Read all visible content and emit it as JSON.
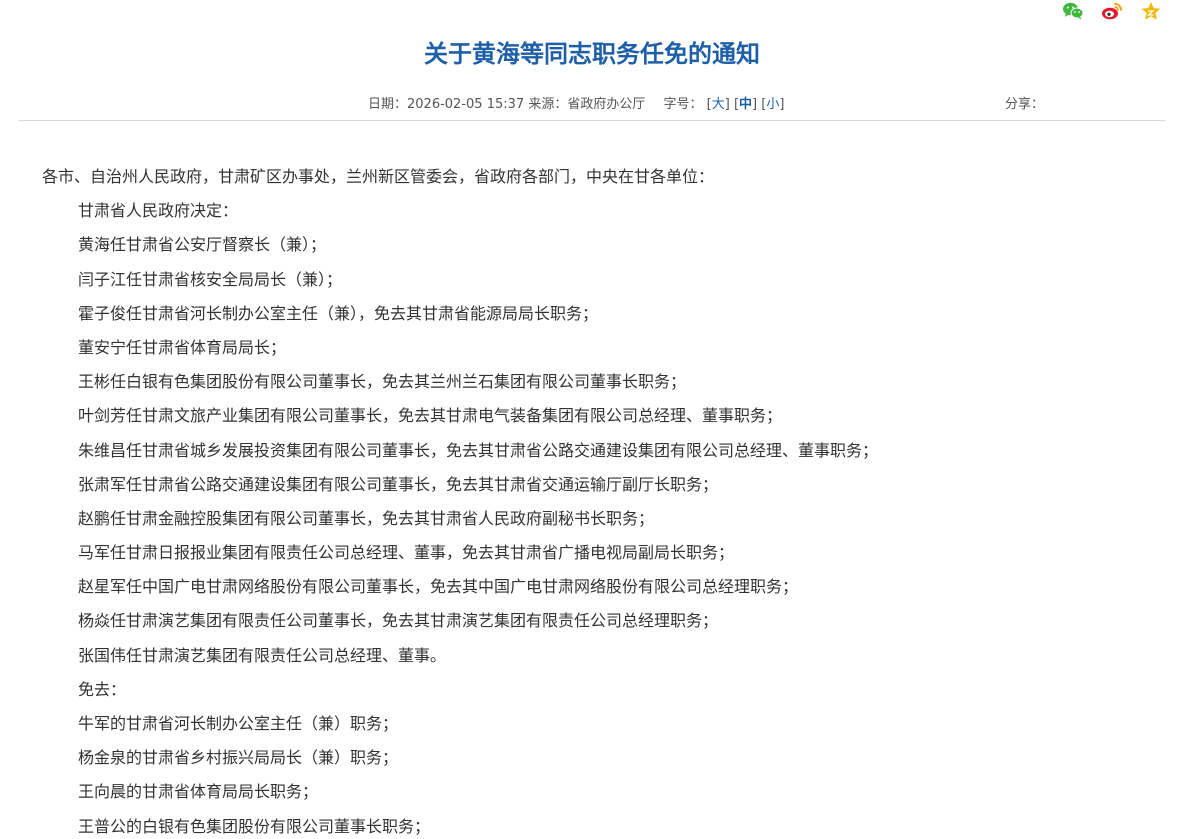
{
  "article": {
    "title": "关于黄海等同志职务任免的通知",
    "date_label": "日期：",
    "date": "2026-02-05 15:37",
    "source_label": "来源：",
    "source": "省政府办公厅",
    "fontsize_label": "字号：",
    "fontsize_options": [
      "大",
      "中",
      "小"
    ],
    "fontsize_selected": "中",
    "share_label": "分享："
  },
  "share_icons": [
    {
      "icon": "wechat-icon",
      "color": "#3fb83f"
    },
    {
      "icon": "weibo-icon",
      "color": "#e6162d"
    },
    {
      "icon": "favorite-star-icon",
      "color": "#f0b800"
    }
  ],
  "body": {
    "salutation": "各市、自治州人民政府，甘肃矿区办事处，兰州新区管委会，省政府各部门，中央在甘各单位：",
    "paragraphs": [
      "甘肃省人民政府决定：",
      "黄海任甘肃省公安厅督察长（兼）；",
      "闫子江任甘肃省核安全局局长（兼）；",
      "霍子俊任甘肃省河长制办公室主任（兼），免去其甘肃省能源局局长职务；",
      "董安宁任甘肃省体育局局长；",
      "王彬任白银有色集团股份有限公司董事长，免去其兰州兰石集团有限公司董事长职务；",
      "叶剑芳任甘肃文旅产业集团有限公司董事长，免去其甘肃电气装备集团有限公司总经理、董事职务；",
      "朱维昌任甘肃省城乡发展投资集团有限公司董事长，免去其甘肃省公路交通建设集团有限公司总经理、董事职务；",
      "张肃军任甘肃省公路交通建设集团有限公司董事长，免去其甘肃省交通运输厅副厅长职务；",
      "赵鹏任甘肃金融控股集团有限公司董事长，免去其甘肃省人民政府副秘书长职务；",
      "马军任甘肃日报报业集团有限责任公司总经理、董事，免去其甘肃省广播电视局副局长职务；",
      "赵星军任中国广电甘肃网络股份有限公司董事长，免去其中国广电甘肃网络股份有限公司总经理职务；",
      "杨焱任甘肃演艺集团有限责任公司董事长，免去其甘肃演艺集团有限责任公司总经理职务；",
      "张国伟任甘肃演艺集团有限责任公司总经理、董事。",
      "免去：",
      "牛军的甘肃省河长制办公室主任（兼）职务；",
      "杨金泉的甘肃省乡村振兴局局长（兼）职务；",
      "王向晨的甘肃省体育局局长职务；",
      "王普公的白银有色集团股份有限公司董事长职务；"
    ]
  }
}
